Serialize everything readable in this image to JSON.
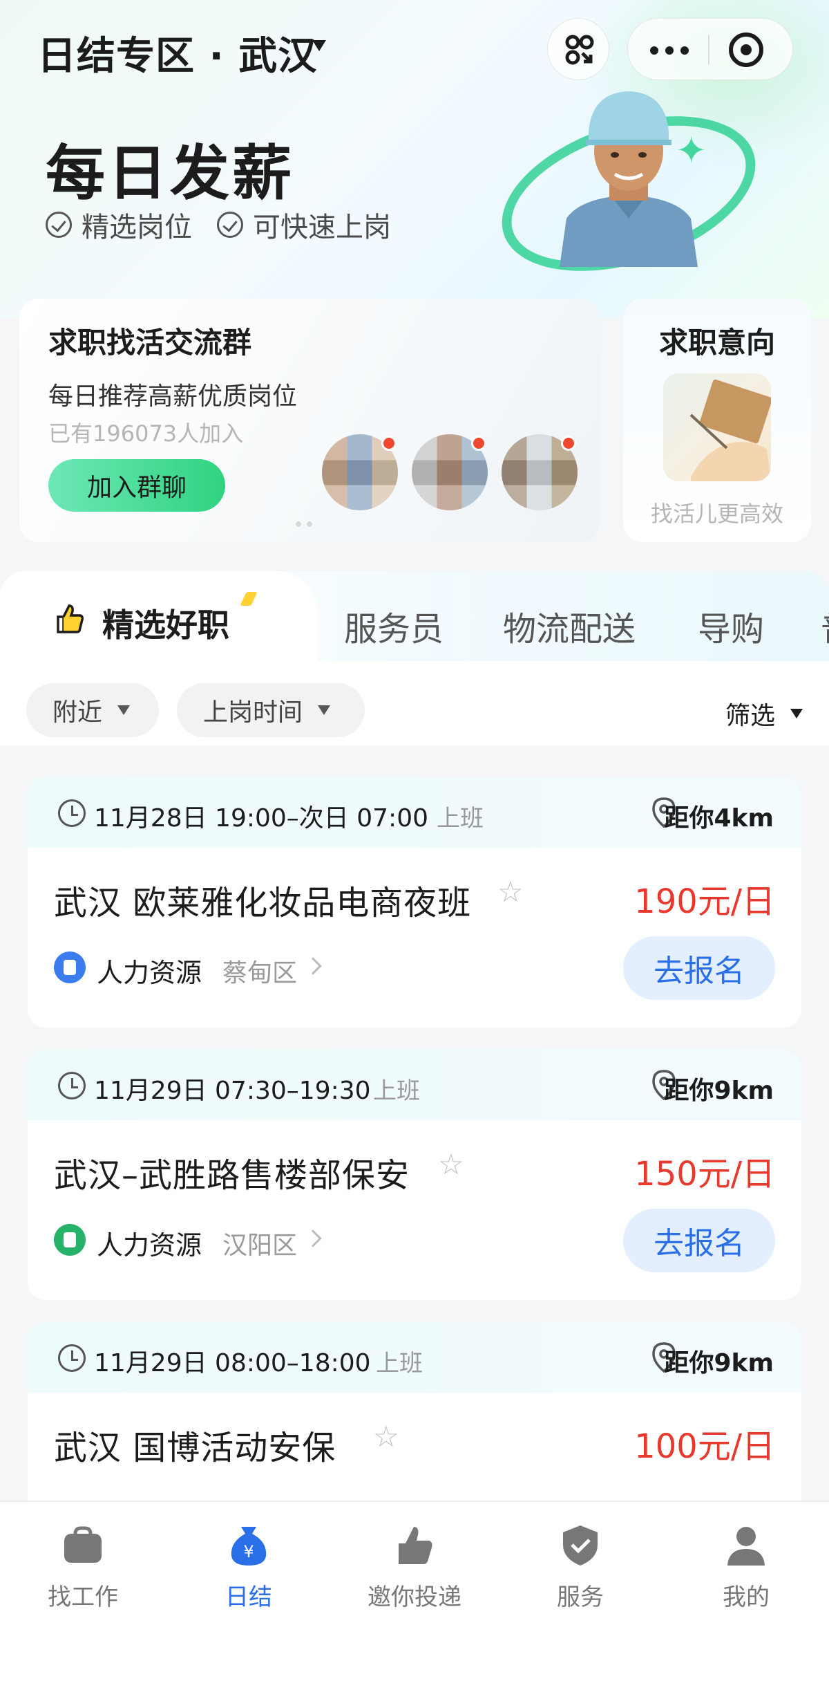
{
  "topbar": {
    "title": "日结专区 · 武汉"
  },
  "hero": {
    "title": "每日发薪",
    "tags": [
      "精选岗位",
      "可快速上岗"
    ]
  },
  "group_card": {
    "title": "求职找活交流群",
    "subtitle": "每日推荐高薪优质岗位",
    "joined": "已有196073人加入",
    "join_label": "加入群聊"
  },
  "intent_card": {
    "title": "求职意向",
    "subtitle": "找活儿更高效"
  },
  "tabs": {
    "active": "精选好职",
    "items": [
      "服务员",
      "物流配送",
      "导购",
      "普"
    ]
  },
  "filters": {
    "nearby": "附近",
    "start_time": "上岗时间",
    "filter": "筛选"
  },
  "jobs": [
    {
      "time": "11月28日 19:00–次日 07:00",
      "shift": "上班",
      "distance": "距你4km",
      "title": "武汉 欧莱雅化妆品电商夜班",
      "salary": "190元/日",
      "company": "人力资源",
      "district": "蔡甸区",
      "apply": "去报名",
      "icon_color": "#3b7cf0"
    },
    {
      "time": "11月29日 07:30–19:30",
      "shift": "上班",
      "distance": "距你9km",
      "title": "武汉–武胜路售楼部保安",
      "salary": "150元/日",
      "company": "人力资源",
      "district": "汉阳区",
      "apply": "去报名",
      "icon_color": "#27b26a"
    },
    {
      "time": "11月29日 08:00–18:00",
      "shift": "上班",
      "distance": "距你9km",
      "title": "武汉 国博活动安保",
      "salary": "100元/日",
      "company": "",
      "district": "",
      "apply": "",
      "icon_color": "#3b7cf0"
    }
  ],
  "bottom_nav": [
    {
      "label": "找工作",
      "icon": "briefcase-icon",
      "active": false
    },
    {
      "label": "日结",
      "icon": "money-bag-icon",
      "active": true
    },
    {
      "label": "邀你投递",
      "icon": "thumbs-up-icon",
      "active": false
    },
    {
      "label": "服务",
      "icon": "shield-check-icon",
      "active": false
    },
    {
      "label": "我的",
      "icon": "user-icon",
      "active": false
    }
  ],
  "colors": {
    "accent_blue": "#2a6fe8",
    "salary_red": "#e8392f",
    "join_green": "#2fd37f"
  }
}
